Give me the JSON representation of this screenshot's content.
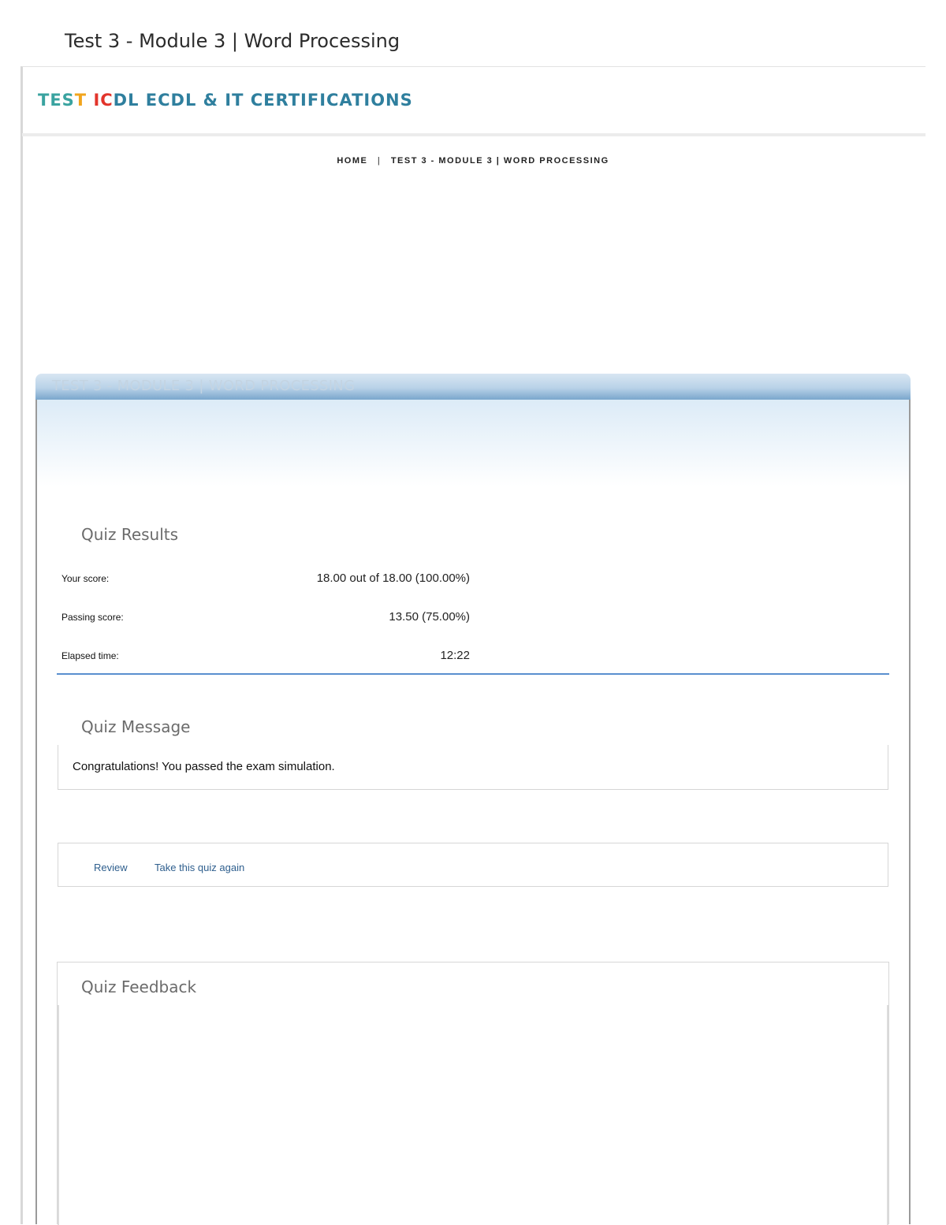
{
  "document": {
    "title": "Test 3 - Module 3 | Word Processing"
  },
  "brand": {
    "part1": "TES",
    "part2": "T",
    "part3": "IC",
    "part4": "DL ECDL & IT CERTIFICATIONS"
  },
  "breadcrumb": {
    "home": "HOME",
    "separator": "|",
    "current": "TEST 3 - MODULE 3 | WORD PROCESSING"
  },
  "panel": {
    "title": "TEST 3 - MODULE 3 | WORD PROCESSING"
  },
  "results": {
    "heading": "Quiz Results",
    "rows": [
      {
        "label": "Your score:",
        "value": "18.00 out of 18.00 (100.00%)"
      },
      {
        "label": "Passing score:",
        "value": "13.50 (75.00%)"
      },
      {
        "label": "Elapsed time:",
        "value": "12:22"
      }
    ]
  },
  "message": {
    "heading": "Quiz Message",
    "text": "Congratulations! You passed the exam simulation."
  },
  "actions": {
    "review": "Review",
    "retake": "Take this quiz again"
  },
  "feedback": {
    "heading": "Quiz Feedback"
  },
  "colors": {
    "accent_blue": "#5a8fcf",
    "brand_teal": "#2f7f9e",
    "link_blue": "#2f5f8e"
  }
}
